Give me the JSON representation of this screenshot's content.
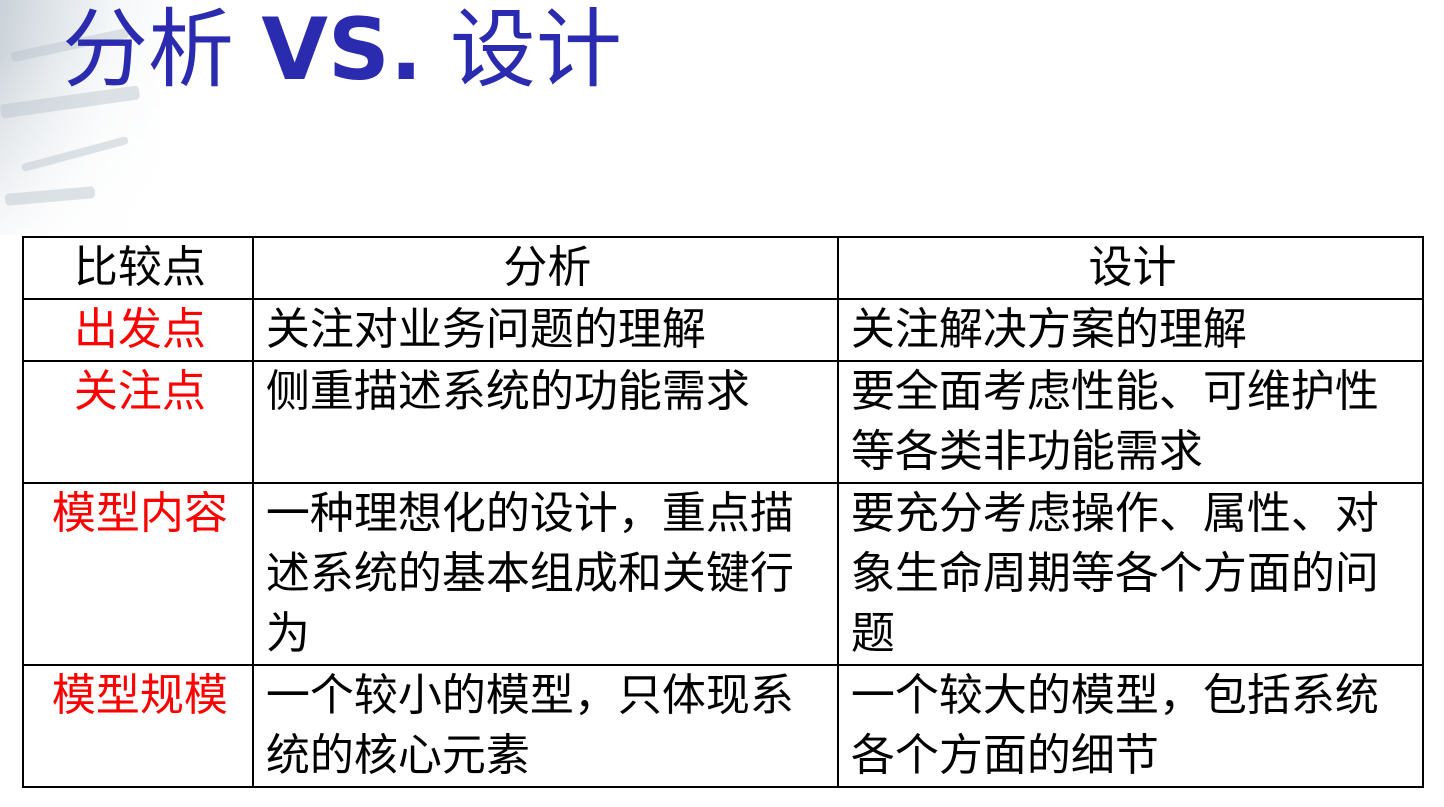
{
  "slide": {
    "title_part1": "分析",
    "title_part2": "VS.",
    "title_part3": "设计",
    "accent_color": "#2b2bb0",
    "key_color": "#ff0000"
  },
  "table": {
    "headers": [
      "比较点",
      "分析",
      "设计"
    ],
    "rows": [
      {
        "key": "出发点",
        "analysis": "关注对业务问题的理解",
        "design": "关注解决方案的理解"
      },
      {
        "key": "关注点",
        "analysis": "侧重描述系统的功能需求",
        "design": "要全面考虑性能、可维护性等各类非功能需求"
      },
      {
        "key": "模型内容",
        "analysis": "一种理想化的设计，重点描述系统的基本组成和关键行为",
        "design": "要充分考虑操作、属性、对象生命周期等各个方面的问题"
      },
      {
        "key": "模型规模",
        "analysis": "一个较小的模型，只体现系统的核心元素",
        "design": "一个较大的模型，包括系统各个方面的细节"
      }
    ]
  }
}
